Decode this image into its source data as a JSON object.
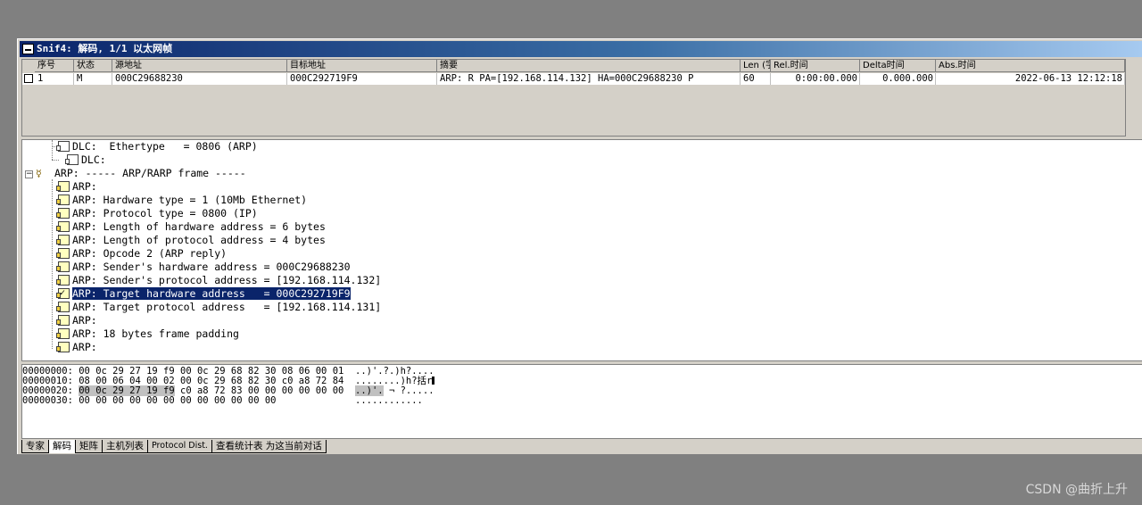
{
  "window": {
    "title": "Snif4: 解码, 1/1 以太网帧"
  },
  "packet_list": {
    "columns": [
      "序号",
      "状态",
      "源地址",
      "目标地址",
      "摘要",
      "Len (字",
      "Rel.时间",
      "Delta时间",
      "Abs.时间"
    ],
    "rows": [
      {
        "num": "1",
        "status": "M",
        "src": "000C29688230",
        "dst": "000C292719F9",
        "summary": "ARP: R PA=[192.168.114.132] HA=000C29688230 P",
        "len": "60",
        "rel": "0:00:00.000",
        "delta": "0.000.000",
        "abs": "2022-06-13 12:12:18"
      }
    ]
  },
  "decode_tree": [
    "DLC:  Ethertype   = 0806 (ARP)",
    "DLC:",
    "ARP: ----- ARP/RARP frame -----",
    "ARP:",
    "ARP: Hardware type = 1 (10Mb Ethernet)",
    "ARP: Protocol type = 0800 (IP)",
    "ARP: Length of hardware address = 6 bytes",
    "ARP: Length of protocol address = 4 bytes",
    "ARP: Opcode 2 (ARP reply)",
    "ARP: Sender's hardware address = 000C29688230",
    "ARP: Sender's protocol address = [192.168.114.132]",
    "ARP: Target hardware address   = 000C292719F9",
    "ARP: Target protocol address   = [192.168.114.131]",
    "ARP:",
    "ARP: 18 bytes frame padding",
    "ARP:"
  ],
  "hex_dump": [
    {
      "offset": "00000000:",
      "bytes_pre": "00 0c 29 27 19 f9 00 0c 29 68 82 30 08 06 00 01",
      "bytes_hl": "",
      "bytes_post": "",
      "ascii_pre": "..)'.?.)h?....",
      "ascii_hl": "",
      "ascii_post": ""
    },
    {
      "offset": "00000010:",
      "bytes_pre": "08 00 06 04 00 02 00 0c 29 68 82 30 c0 a8 72 84",
      "bytes_hl": "",
      "bytes_post": "",
      "ascii_pre": "........)h?括r",
      "ascii_hl": "",
      "ascii_post": ""
    },
    {
      "offset": "00000020:",
      "bytes_pre": "",
      "bytes_hl": "00 0c 29 27 19 f9",
      "bytes_post": " c0 a8 72 83 00 00 00 00 00 00",
      "ascii_pre": "",
      "ascii_hl": "..)'.",
      "ascii_post": " ¬ ?....."
    },
    {
      "offset": "00000030:",
      "bytes_pre": "00 00 00 00 00 00 00 00 00 00 00 00",
      "bytes_hl": "",
      "bytes_post": "",
      "ascii_pre": "............",
      "ascii_hl": "",
      "ascii_post": ""
    }
  ],
  "tabs": [
    "专家",
    "解码",
    "矩阵",
    "主机列表",
    "Protocol Dist.",
    "查看统计表 为这当前对话"
  ],
  "active_tab": "解码",
  "watermark": "CSDN @曲折上升"
}
